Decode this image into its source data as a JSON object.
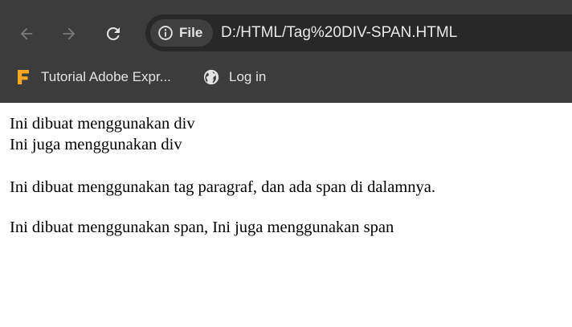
{
  "browser": {
    "site_chip_label": "File",
    "url": "D:/HTML/Tag%20DIV-SPAN.HTML",
    "bookmarks": [
      {
        "label": "Tutorial Adobe Expr...",
        "icon": "adobe-express-icon"
      },
      {
        "label": "Log in",
        "icon": "globe-icon"
      }
    ]
  },
  "page": {
    "div_1": "Ini dibuat menggunakan div",
    "div_2": "Ini juga menggunakan div",
    "paragraph": "Ini dibuat menggunakan tag paragraf, dan ada span di dalamnya.",
    "spans": "Ini dibuat menggunakan span, Ini juga menggunakan span"
  },
  "colors": {
    "chrome": "#3c3c3c",
    "omnibox": "#282828",
    "bookmark_icon_accent": "#f5a623"
  }
}
